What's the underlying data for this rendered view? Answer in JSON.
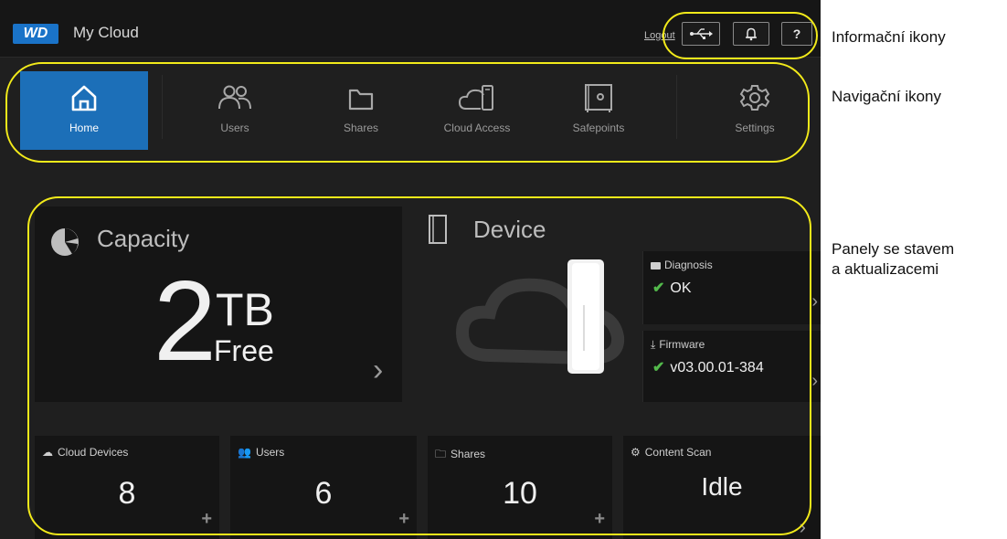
{
  "header": {
    "logo": "WD",
    "app_title": "My Cloud",
    "logout": "Logout"
  },
  "info_icons": [
    "usb-icon",
    "bell-icon",
    "help-icon"
  ],
  "help_glyph": "?",
  "nav": {
    "items": [
      {
        "label": "Home",
        "icon": "home-icon"
      },
      {
        "label": "Users",
        "icon": "users-icon"
      },
      {
        "label": "Shares",
        "icon": "folder-icon"
      },
      {
        "label": "Cloud Access",
        "icon": "cloud-device-icon"
      },
      {
        "label": "Safepoints",
        "icon": "safe-icon"
      },
      {
        "label": "Settings",
        "icon": "gear-icon"
      }
    ],
    "active": "Home"
  },
  "capacity": {
    "title": "Capacity",
    "value": "2",
    "unit": "TB",
    "status": "Free"
  },
  "device": {
    "title": "Device",
    "diagnosis": {
      "label": "Diagnosis",
      "value": "OK"
    },
    "firmware": {
      "label": "Firmware",
      "value": "v03.00.01-384"
    }
  },
  "tiles": [
    {
      "label": "Cloud Devices",
      "value": "8"
    },
    {
      "label": "Users",
      "value": "6"
    },
    {
      "label": "Shares",
      "value": "10"
    },
    {
      "label": "Content Scan",
      "value": "Idle"
    }
  ],
  "annotations": {
    "info": "Informační ikony",
    "nav": "Navigační ikony",
    "panels_line1": "Panely se stavem",
    "panels_line2": "a aktualizacemi"
  },
  "colors": {
    "accent": "#1c6fb8",
    "highlight": "#f2ea1a",
    "ok": "#53b94b",
    "background": "#1f1f1f"
  }
}
